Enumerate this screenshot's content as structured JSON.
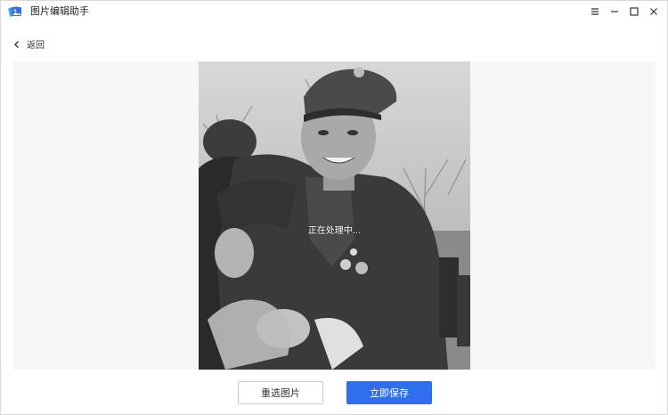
{
  "app": {
    "title": "图片编辑助手",
    "icon": "image-editor-app-icon"
  },
  "window_controls": {
    "menu_icon": "menu-icon",
    "minimize_icon": "minimize-icon",
    "maximize_icon": "maximize-icon",
    "close_icon": "close-icon"
  },
  "nav": {
    "back_label": "返回",
    "back_icon": "chevron-left-icon"
  },
  "preview": {
    "status_text": "正在处理中..."
  },
  "actions": {
    "reselect_label": "重选图片",
    "save_label": "立即保存"
  },
  "colors": {
    "primary": "#2f6fef",
    "preview_bg": "#f6f7f9"
  }
}
